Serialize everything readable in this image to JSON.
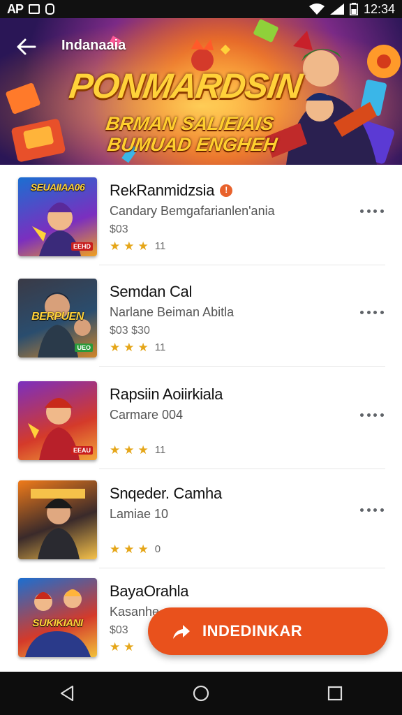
{
  "status_bar": {
    "left_indicator": "AP",
    "time": "12:34"
  },
  "banner": {
    "app_title": "Indanaaia",
    "headline": "PONMARDSIN",
    "subline1": "BRMAN SALIEIAIS",
    "subline2": "BUMUAD ENGHEH"
  },
  "apps": [
    {
      "title": "RekRanmidzsia",
      "subtitle": "Candary Bemgafarianlen'ania",
      "price": "$03",
      "rating": "11",
      "thumb_text": "SEUAIIAA06",
      "thumb_badge": "EEHD",
      "thumb_colors": [
        "#1b6fd1",
        "#7b2fbf",
        "#f0a020"
      ]
    },
    {
      "title": "Semdan Cal",
      "subtitle": "Narlane Beiman Abitla",
      "price": "$03 $30",
      "rating": "11",
      "thumb_text": "BERPUEN",
      "thumb_badge": "UEO",
      "thumb_colors": [
        "#3a3a46",
        "#2a4d6e",
        "#d0862a"
      ]
    },
    {
      "title": "Rapsiin Aoiirkiala",
      "subtitle": "Carmare 004",
      "price": "",
      "rating": "11",
      "thumb_text": "",
      "thumb_badge": "EEAU",
      "thumb_colors": [
        "#7b2fbf",
        "#d43a2a",
        "#f2a53a"
      ]
    },
    {
      "title": "Snqeder. Camha",
      "subtitle": "Lamiae 10",
      "price": "",
      "rating": "0",
      "thumb_text": "",
      "thumb_badge": "",
      "thumb_colors": [
        "#f07b1a",
        "#3a2a2a",
        "#f6c24a"
      ]
    },
    {
      "title": "BayaOrahla",
      "subtitle": "Kasanhe",
      "price": "$03",
      "rating": "",
      "thumb_text": "SUKIKIANI",
      "thumb_badge": "",
      "thumb_colors": [
        "#1b6fd1",
        "#d43a2a",
        "#f2c13a"
      ]
    }
  ],
  "fab": {
    "label": "INDEDINKAR",
    "color": "#e9511c"
  },
  "accent_color": "#e9511c",
  "star_color": "#e5a619"
}
